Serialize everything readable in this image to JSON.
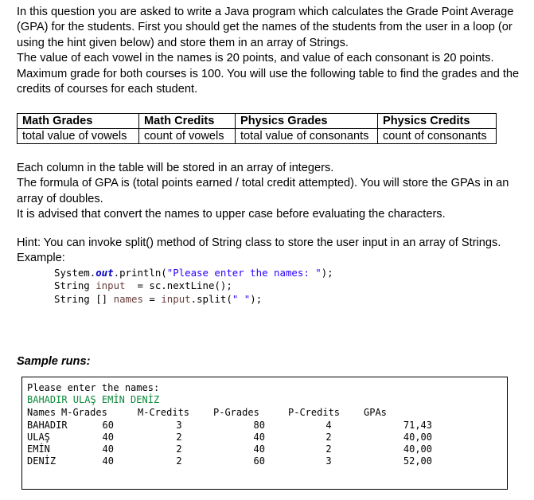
{
  "intro": [
    "In this question you are asked to write a Java program which calculates the Grade Point Average",
    "(GPA) for the students. First you should get the names of the students from the user in a loop (or",
    "using the hint given below) and store them in an array of Strings.",
    "The value of each vowel in the names is 20 points, and value of each consonant is 20 points.",
    "Maximum grade for both courses is 100. You will use the following table to find the grades and the",
    "credits of courses for each student."
  ],
  "spec_table": {
    "headers": [
      "Math Grades",
      "Math Credits",
      "Physics Grades",
      "Physics Credits"
    ],
    "row": [
      "total value of vowels",
      "count of vowels",
      "total value of consonants",
      "count of consonants"
    ]
  },
  "body": [
    "Each column in the table will be stored in an array of integers.",
    "The formula of GPA is (total points earned / total credit attempted). You will store the GPAs in an",
    "array of doubles.",
    "It is advised that convert the names to upper case before evaluating the characters."
  ],
  "hint": [
    "Hint: You can invoke split() method of String class to store the user input in an array of Strings.",
    "Example:"
  ],
  "code": {
    "line1_a": "System.",
    "line1_out": "out",
    "line1_b": ".println(",
    "line1_str": "\"Please enter the names: \"",
    "line1_c": ");",
    "line2_a": "String ",
    "line2_var": "input",
    "line2_b": "  = sc.nextLine();",
    "line3_a": "String [] ",
    "line3_var": "names",
    "line3_b": " = ",
    "line3_var2": "input",
    "line3_c": ".split(",
    "line3_str": "\" \"",
    "line3_d": ");"
  },
  "sample_title": "Sample runs:",
  "console": {
    "prompt": "Please enter the names:",
    "input": "BAHADIR ULAŞ EMİN DENİZ",
    "headers": [
      "Names",
      "M-Grades",
      "M-Credits",
      "P-Grades",
      "P-Credits",
      "GPAs"
    ],
    "rows": [
      {
        "name": "BAHADIR",
        "mg": "60",
        "mc": "3",
        "pg": "80",
        "pc": "4",
        "gpa": "71,43"
      },
      {
        "name": "ULAŞ",
        "mg": "40",
        "mc": "2",
        "pg": "40",
        "pc": "2",
        "gpa": "40,00"
      },
      {
        "name": "EMİN",
        "mg": "40",
        "mc": "2",
        "pg": "40",
        "pc": "2",
        "gpa": "40,00"
      },
      {
        "name": "DENİZ",
        "mg": "40",
        "mc": "2",
        "pg": "60",
        "pc": "3",
        "gpa": "52,00"
      }
    ]
  }
}
